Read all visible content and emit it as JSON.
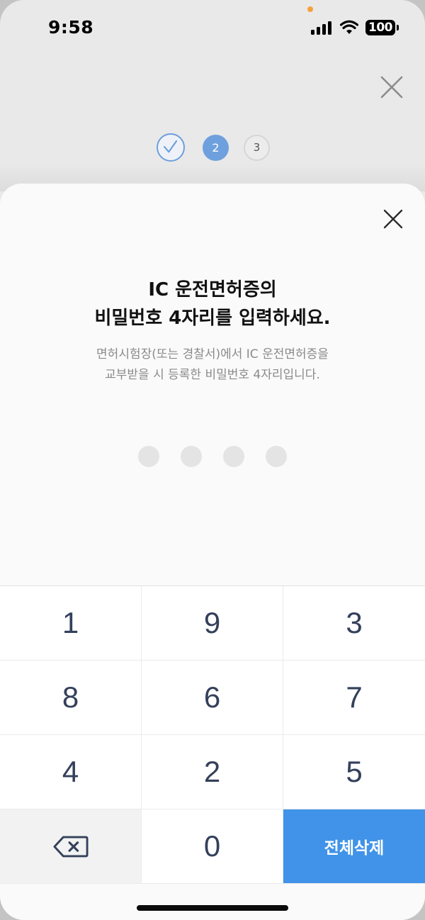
{
  "status_bar": {
    "time": "9:58",
    "battery": "100",
    "icons": [
      "signal-icon",
      "wifi-icon",
      "battery-icon"
    ]
  },
  "background_page": {
    "steps": [
      {
        "label": "",
        "state": "done",
        "icon": "checkmark-icon"
      },
      {
        "label": "2",
        "state": "current"
      },
      {
        "label": "3",
        "state": "upcoming"
      }
    ],
    "close_icon": "close-icon"
  },
  "sheet": {
    "title_line1": "IC 운전면허증의",
    "title_line2": "비밀번호 4자리를 입력하세요.",
    "subtitle_line1": "면허시험장(또는 경찰서)에서 IC 운전면허증을",
    "subtitle_line2": "교부받을 시 등록한 비밀번호 4자리입니다.",
    "pin_length": 4,
    "pin_entered": 0,
    "close_icon": "close-icon"
  },
  "keypad": {
    "keys": [
      "1",
      "9",
      "3",
      "8",
      "6",
      "7",
      "4",
      "2",
      "5"
    ],
    "zero": "0",
    "backspace_icon": "backspace-icon",
    "clear_all": "전체삭제"
  },
  "colors": {
    "accent": "#4093e8",
    "step_current": "#6fa0de",
    "key_text": "#34405b",
    "subtitle_text": "#8a8a8a",
    "pin_dot_empty": "#e4e4e4"
  }
}
